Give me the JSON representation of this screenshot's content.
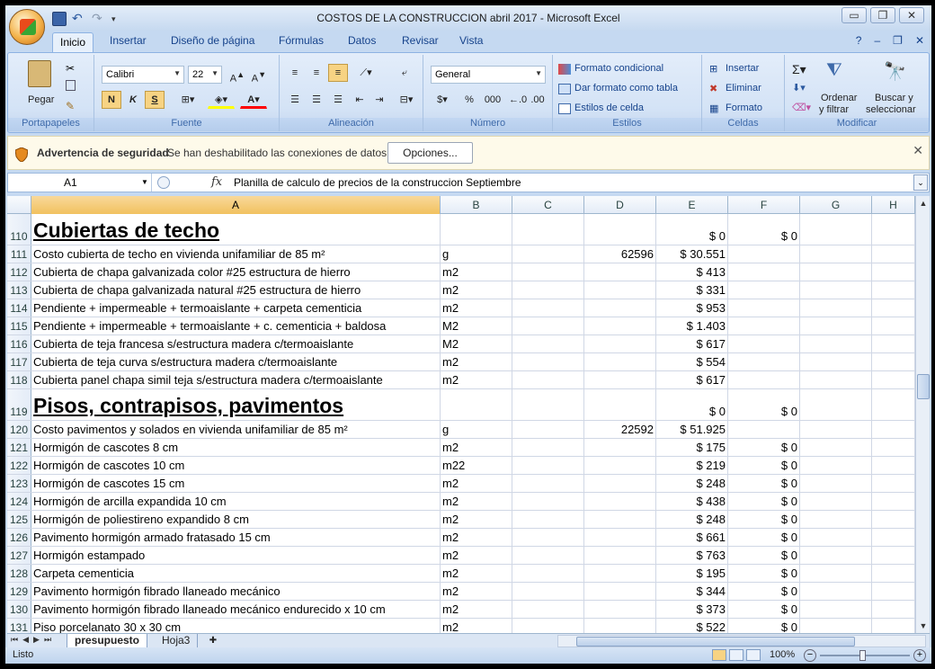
{
  "window": {
    "title": "COSTOS DE LA CONSTRUCCION abril 2017 - Microsoft Excel",
    "minimize": "▭",
    "restore": "❐",
    "close": "✕"
  },
  "tabs": [
    "Inicio",
    "Insertar",
    "Diseño de página",
    "Fórmulas",
    "Datos",
    "Revisar",
    "Vista"
  ],
  "ribbon": {
    "portapapeles": {
      "label": "Portapapeles",
      "pegar": "Pegar"
    },
    "fuente": {
      "label": "Fuente",
      "font_name": "Calibri",
      "font_size": "22",
      "bold": "N",
      "italic": "K",
      "underline": "S"
    },
    "alineacion": {
      "label": "Alineación"
    },
    "numero": {
      "label": "Número",
      "format": "General",
      "currency": "$",
      "percent": "%",
      "thousands": "000"
    },
    "estilos": {
      "label": "Estilos",
      "formato_condicional": "Formato condicional",
      "dar_formato_tabla": "Dar formato como tabla",
      "estilos_celda": "Estilos de celda"
    },
    "celdas": {
      "label": "Celdas",
      "insertar": "Insertar",
      "eliminar": "Eliminar",
      "formato": "Formato"
    },
    "modificar": {
      "label": "Modificar",
      "ordenar": "Ordenar",
      "filtrar": "y filtrar",
      "buscar": "Buscar y",
      "seleccionar": "seleccionar"
    }
  },
  "security": {
    "title": "Advertencia de seguridad",
    "message": "Se han deshabilitado las conexiones de datos",
    "options_button": "Opciones...",
    "close": "✕"
  },
  "formula_bar": {
    "name_box": "A1",
    "fx": "fx",
    "formula": "Planilla de calculo de precios de la construccion Septiembre"
  },
  "columns": [
    "A",
    "B",
    "C",
    "D",
    "E",
    "F",
    "G",
    "H"
  ],
  "rows": [
    {
      "n": "110",
      "a": "Cubiertas de techo",
      "b": "",
      "d": "",
      "e": "$ 0",
      "f": "$ 0",
      "heading": true
    },
    {
      "n": "111",
      "a": "Costo cubierta de techo en vivienda unifamiliar de 85 m²",
      "b": "g",
      "d": "62596",
      "e": "$ 30.551",
      "f": ""
    },
    {
      "n": "112",
      "a": "Cubierta de chapa galvanizada color #25 estructura de hierro",
      "b": "m2",
      "d": "",
      "e": "$ 413",
      "f": ""
    },
    {
      "n": "113",
      "a": "Cubierta de chapa galvanizada natural #25 estructura de hierro",
      "b": "m2",
      "d": "",
      "e": "$ 331",
      "f": ""
    },
    {
      "n": "114",
      "a": "Pendiente + impermeable + termoaislante + carpeta cementicia",
      "b": "m2",
      "d": "",
      "e": "$ 953",
      "f": ""
    },
    {
      "n": "115",
      "a": "Pendiente + impermeable + termoaislante + c. cementicia + baldosa",
      "b": "M2",
      "d": "",
      "e": "$ 1.403",
      "f": ""
    },
    {
      "n": "116",
      "a": "Cubierta de teja francesa s/estructura madera c/termoaislante",
      "b": "M2",
      "d": "",
      "e": "$ 617",
      "f": ""
    },
    {
      "n": "117",
      "a": "Cubierta de teja curva s/estructura madera c/termoaislante",
      "b": "m2",
      "d": "",
      "e": "$ 554",
      "f": ""
    },
    {
      "n": "118",
      "a": "Cubierta panel chapa simil teja s/estructura madera c/termoaislante",
      "b": "m2",
      "d": "",
      "e": "$ 617",
      "f": ""
    },
    {
      "n": "119",
      "a": "Pisos, contrapisos, pavimentos",
      "b": "",
      "d": "",
      "e": "$ 0",
      "f": "$ 0",
      "heading": true
    },
    {
      "n": "120",
      "a": "Costo pavimentos y solados en vivienda unifamiliar de 85 m²",
      "b": "g",
      "d": "22592",
      "e": "$ 51.925",
      "f": ""
    },
    {
      "n": "121",
      "a": "Hormigón de cascotes 8 cm",
      "b": "m2",
      "d": "",
      "e": "$ 175",
      "f": "$ 0"
    },
    {
      "n": "122",
      "a": "Hormigón de cascotes 10 cm",
      "b": "m22",
      "d": "",
      "e": "$ 219",
      "f": "$ 0"
    },
    {
      "n": "123",
      "a": "Hormigón de cascotes 15 cm",
      "b": "m2",
      "d": "",
      "e": "$ 248",
      "f": "$ 0"
    },
    {
      "n": "124",
      "a": "Hormigón de arcilla expandida 10 cm",
      "b": "m2",
      "d": "",
      "e": "$ 438",
      "f": "$ 0"
    },
    {
      "n": "125",
      "a": "Hormigón de poliestireno expandido 8 cm",
      "b": "m2",
      "d": "",
      "e": "$ 248",
      "f": "$ 0"
    },
    {
      "n": "126",
      "a": "Pavimento hormigón armado fratasado 15 cm",
      "b": "m2",
      "d": "",
      "e": "$ 661",
      "f": "$ 0"
    },
    {
      "n": "127",
      "a": "Hormigón estampado",
      "b": "m2",
      "d": "",
      "e": "$ 763",
      "f": "$ 0"
    },
    {
      "n": "128",
      "a": "Carpeta cementicia",
      "b": "m2",
      "d": "",
      "e": "$ 195",
      "f": "$ 0"
    },
    {
      "n": "129",
      "a": "Pavimento hormigón fibrado llaneado mecánico",
      "b": "m2",
      "d": "",
      "e": "$ 344",
      "f": "$ 0"
    },
    {
      "n": "130",
      "a": "Pavimento hormigón fibrado llaneado mecánico endurecido x 10 cm",
      "b": "m2",
      "d": "",
      "e": "$ 373",
      "f": "$ 0"
    },
    {
      "n": "131",
      "a": "Piso porcelanato 30 x 30 cm",
      "b": "m2",
      "d": "",
      "e": "$ 522",
      "f": "$ 0"
    }
  ],
  "sheet_tabs": [
    "presupuesto",
    "Hoja3"
  ],
  "status": {
    "text": "Listo",
    "zoom": "100%",
    "zoom_minus": "−",
    "zoom_plus": "+"
  }
}
